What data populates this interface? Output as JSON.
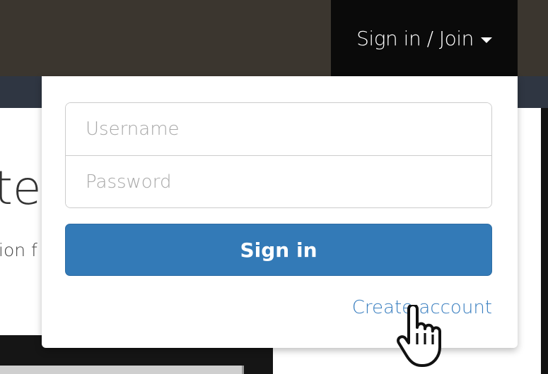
{
  "header": {
    "nav_label": "Sign in / Join"
  },
  "page": {
    "title_fragment": "te",
    "subtitle_fragment": "ion f"
  },
  "login": {
    "username_placeholder": "Username",
    "password_placeholder": "Password",
    "submit_label": "Sign in",
    "create_account_label": "Create account"
  },
  "colors": {
    "primary": "#337ab7",
    "link": "#3a7fc0",
    "header": "#3b362f"
  }
}
